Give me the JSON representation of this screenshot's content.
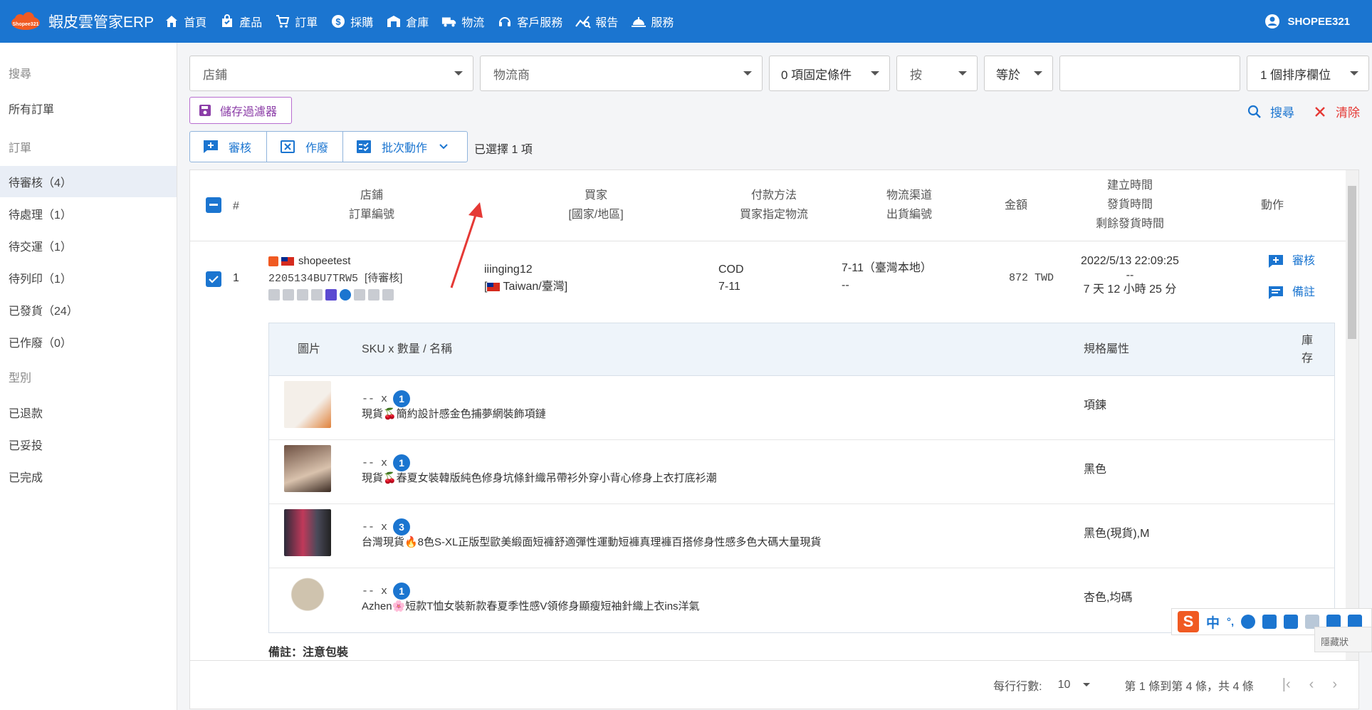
{
  "app": {
    "brand": "蝦皮雲管家ERP",
    "logo_text": "Shopee321"
  },
  "nav": [
    {
      "label": "首頁",
      "icon": "home-icon"
    },
    {
      "label": "產品",
      "icon": "bag-icon"
    },
    {
      "label": "訂單",
      "icon": "cart-icon"
    },
    {
      "label": "採購",
      "icon": "dollar-icon"
    },
    {
      "label": "倉庫",
      "icon": "warehouse-icon"
    },
    {
      "label": "物流",
      "icon": "truck-icon"
    },
    {
      "label": "客戶服務",
      "icon": "support-icon"
    },
    {
      "label": "報告",
      "icon": "chart-icon"
    },
    {
      "label": "服務",
      "icon": "service-bell-icon"
    }
  ],
  "user": {
    "name": "SHOPEE321"
  },
  "sidebar": {
    "items": [
      {
        "label": "搜尋",
        "type": "section"
      },
      {
        "label": "所有訂單",
        "type": "item"
      },
      {
        "label": "訂單",
        "type": "section"
      },
      {
        "label": "待審核（4）",
        "type": "item",
        "active": true
      },
      {
        "label": "待處理（1）",
        "type": "item"
      },
      {
        "label": "待交運（1）",
        "type": "item"
      },
      {
        "label": "待列印（1）",
        "type": "item"
      },
      {
        "label": "已發貨（24）",
        "type": "item"
      },
      {
        "label": "已作廢（0）",
        "type": "item"
      },
      {
        "label": "型別",
        "type": "section"
      },
      {
        "label": "已退款",
        "type": "item"
      },
      {
        "label": "已妥投",
        "type": "item"
      },
      {
        "label": "已完成",
        "type": "item"
      }
    ]
  },
  "filters": {
    "shop": "店鋪",
    "carrier": "物流商",
    "fixed_conditions": "0 項固定條件",
    "by": "按",
    "operator": "等於",
    "value": "",
    "sort": "1 個排序欄位"
  },
  "toolbar": {
    "save_filter": "儲存過濾器",
    "search": "搜尋",
    "clear": "清除",
    "audit": "審核",
    "void": "作廢",
    "batch": "批次動作",
    "selected": "已選擇 1 項"
  },
  "table": {
    "headers": {
      "hash": "#",
      "shop_l1": "店鋪",
      "shop_l2": "訂單編號",
      "buyer_l1": "買家",
      "buyer_l2": "[國家/地區]",
      "pay_l1": "付款方法",
      "pay_l2": "買家指定物流",
      "ship_l1": "物流渠道",
      "ship_l2": "出貨編號",
      "amount": "金額",
      "time_l1": "建立時間",
      "time_l2": "發貨時間",
      "time_l3": "剩餘發貨時間",
      "action": "動作"
    },
    "order": {
      "index": "1",
      "shop": "shopeetest",
      "order_no": "2205134BU7TRW5",
      "status": "[待審核]",
      "buyer": "iiinging12",
      "country": "Taiwan/臺灣",
      "payment": "COD",
      "buyer_logistics": "7-11",
      "channel": "7-11（臺灣本地）",
      "shipment_no": "--",
      "amount": "872",
      "currency": "TWD",
      "created": "2022/5/13 22:09:25",
      "shipped": "--",
      "remaining": "7 天 12 小時 25 分",
      "act_audit": "審核",
      "act_note": "備註"
    },
    "items_header": {
      "image": "圖片",
      "sku": "SKU x 數量 / 名稱",
      "spec": "規格屬性",
      "stock": "庫存"
    },
    "items": [
      {
        "sku": "-- x",
        "qty": "1",
        "name": "現貨🍒簡約設計感金色捕夢網裝飾項鏈",
        "spec": "項鍊",
        "thumb": "#d9b48a"
      },
      {
        "sku": "-- x",
        "qty": "1",
        "name": "現貨🍒春夏女裝韓版純色修身坑條針織吊帶衫外穿小背心修身上衣打底衫潮",
        "spec": "黑色",
        "thumb": "#7a5a4a"
      },
      {
        "sku": "-- x",
        "qty": "3",
        "name": "台灣現貨🔥8色S-XL正版型歐美緞面短褲舒適彈性運動短褲真理褲百搭修身性感多色大碼大量現貨",
        "spec": "黑色(現貨),M",
        "thumb": "#4a4a5a"
      },
      {
        "sku": "-- x",
        "qty": "1",
        "name": "Azhen🌸短款T恤女裝新款春夏季性感V領修身顯瘦短袖針織上衣ins洋氣",
        "spec": "杏色,均碼",
        "thumb": "#cfc3ae"
      }
    ],
    "note": "備註：注意包裝"
  },
  "footer": {
    "rows_per_page_label": "每行行數:",
    "rows_per_page": "10",
    "range": "第 1 條到第 4 條，共 4 條"
  },
  "ime": {
    "mode": "中",
    "tip": "隱藏狀"
  }
}
